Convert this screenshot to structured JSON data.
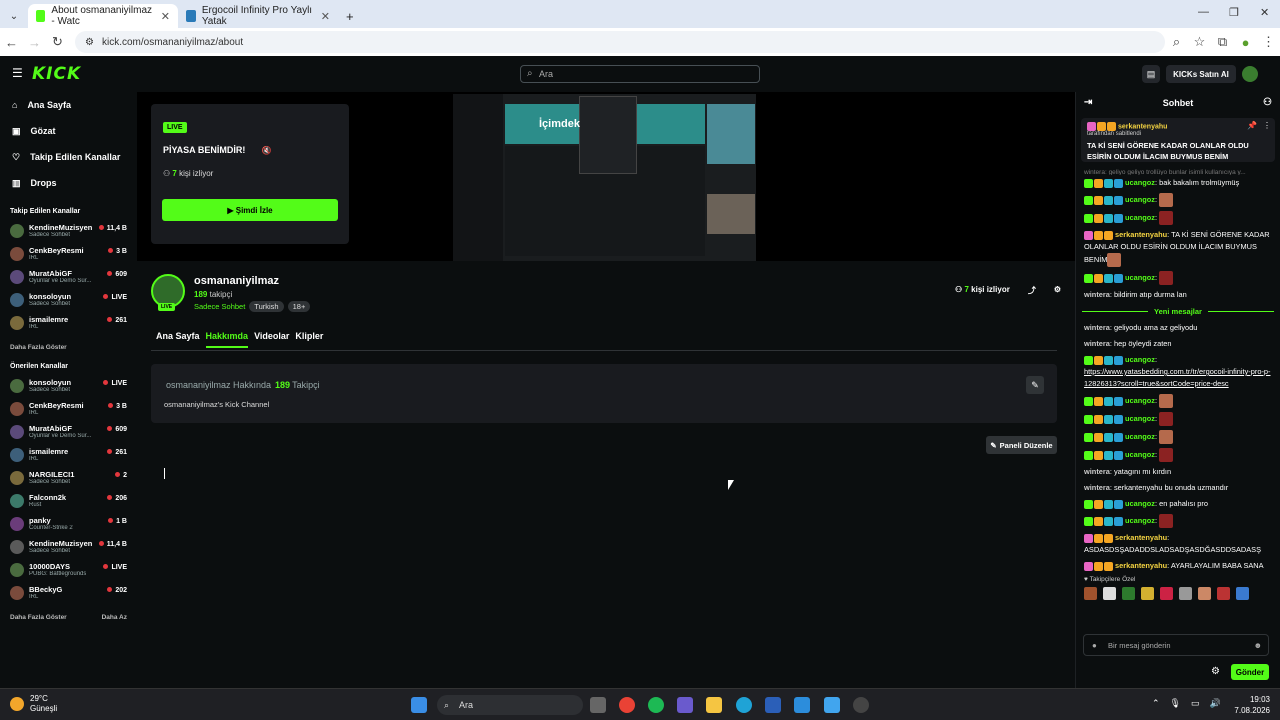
{
  "browser": {
    "tabs": [
      {
        "label": "About osmananiyilmaz - Watc",
        "active": true,
        "color": "#53fc18"
      },
      {
        "label": "Ergocoil Infinity Pro Yaylı Yatak",
        "active": false,
        "color": "#2a7ab8"
      }
    ],
    "url": "kick.com/osmananiyilmaz/about"
  },
  "header": {
    "logo": "KICK",
    "search_placeholder": "Ara",
    "buy_label": "KICKs Satın Al"
  },
  "sidebar": {
    "nav": [
      {
        "label": "Ana Sayfa",
        "icon": "home-icon"
      },
      {
        "label": "Gözat",
        "icon": "browse-icon"
      },
      {
        "label": "Takip Edilen Kanallar",
        "icon": "heart-icon"
      },
      {
        "label": "Drops",
        "icon": "drops-icon"
      }
    ],
    "followed_title": "Takip Edilen Kanallar",
    "followed": [
      {
        "name": "KendineMuzisyen",
        "cat": "Sadece Sohbet",
        "count": "11,4 B"
      },
      {
        "name": "CenkBeyResmi",
        "cat": "IRL",
        "count": "3 B"
      },
      {
        "name": "MuratAbiGF",
        "cat": "Oyunlar ve Demo Sür...",
        "count": "609"
      },
      {
        "name": "konsoloyun",
        "cat": "Sadece Sohbet",
        "count": "LIVE"
      },
      {
        "name": "ismailemre",
        "cat": "IRL",
        "count": "261"
      }
    ],
    "show_more": "Daha Fazla Göster",
    "recommended_title": "Önerilen Kanallar",
    "recommended": [
      {
        "name": "konsoloyun",
        "cat": "Sadece Sohbet",
        "count": "LIVE"
      },
      {
        "name": "CenkBeyResmi",
        "cat": "IRL",
        "count": "3 B"
      },
      {
        "name": "MuratAbiGF",
        "cat": "Oyunlar ve Demo Sür...",
        "count": "609"
      },
      {
        "name": "ismailemre",
        "cat": "IRL",
        "count": "261"
      },
      {
        "name": "NARGILECI1",
        "cat": "Sadece Sohbet",
        "count": "2"
      },
      {
        "name": "Falconn2k",
        "cat": "Rust",
        "count": "206"
      },
      {
        "name": "panky",
        "cat": "Counter-Strike 2",
        "count": "1 B"
      },
      {
        "name": "KendineMuzisyen",
        "cat": "Sadece Sohbet",
        "count": "11,4 B"
      },
      {
        "name": "10000DAYS",
        "cat": "PUBG: Battlegrounds",
        "count": "LIVE"
      },
      {
        "name": "BBeckyG",
        "cat": "IRL",
        "count": "202"
      }
    ],
    "show_more2": "Daha Fazla Göster",
    "show_less": "Daha Az"
  },
  "player": {
    "badge": "LIVE",
    "title": "PİYASA BENİMDİR!",
    "viewers_count": "7",
    "viewers_text": "kişi izliyor",
    "watch_label": "Şimdi İzle",
    "preview_text": "İçimdek"
  },
  "channel": {
    "name": "osmananiyilmaz",
    "followers": "189",
    "followers_text": "takipçi",
    "category": "Sadece Sohbet",
    "tags": [
      "Turkish",
      "18+"
    ],
    "viewers": "7",
    "viewers_text": "kişi izliyor",
    "live_badge": "LIVE"
  },
  "tabs": [
    "Ana Sayfa",
    "Hakkımda",
    "Videolar",
    "Klipler"
  ],
  "about": {
    "title": "osmananiyilmaz Hakkında",
    "followers": "189",
    "followers_label": "Takipçi",
    "description": "osmananiyilmaz's Kick Channel",
    "panel_button": "Paneli Düzenle"
  },
  "chat": {
    "title": "Sohbet",
    "pinned": {
      "user": "serkantenyahu",
      "sub": "tarafından sabitlendi",
      "text": "TA Kİ SENİ GÖRENE KADAR OLANLAR OLDU ESİRİN OLDUM İLACIM BUYMUS BENİM"
    },
    "faded": "wintera: geliyo geliyo trollüyo bunlar isimli kullanıcıya y...",
    "messages_before": [
      {
        "user": "ucangoz",
        "text": "bak bakalım trolmüymüş",
        "type": "g"
      },
      {
        "user": "ucangoz",
        "text": "",
        "emote": true,
        "type": "g"
      },
      {
        "user": "ucangoz",
        "text": "",
        "emote": true,
        "type": "g"
      },
      {
        "user": "serkantenyahu",
        "text": "TA Kİ SENİ GÖRENE KADAR OLANLAR OLDU ESİRİN OLDUM İLACIM BUYMUS BENİM",
        "emote": true,
        "type": "p"
      },
      {
        "user": "ucangoz",
        "text": "",
        "emote": true,
        "type": "g"
      },
      {
        "user": "wintera",
        "text": "bildirim atıp durma lan",
        "type": "w"
      }
    ],
    "new_messages": "Yeni mesajlar",
    "messages_after": [
      {
        "user": "wintera",
        "text": "geliyodu ama az geliyodu",
        "type": "w"
      },
      {
        "user": "wintera",
        "text": "hep öyleydi zaten",
        "type": "w"
      },
      {
        "user": "ucangoz",
        "text": "https://www.yatasbedding.com.tr/tr/ergocoil-infinity-pro-p-12826313?scroll=true&sortCode=price-desc",
        "type": "g",
        "link": true
      },
      {
        "user": "ucangoz",
        "text": "",
        "emote": true,
        "type": "g"
      },
      {
        "user": "ucangoz",
        "text": "",
        "emote": true,
        "type": "g"
      },
      {
        "user": "ucangoz",
        "text": "",
        "emote": true,
        "type": "g"
      },
      {
        "user": "ucangoz",
        "text": "",
        "emote": true,
        "type": "g"
      },
      {
        "user": "wintera",
        "text": "yatagını mı kırdın",
        "type": "w"
      },
      {
        "user": "wintera",
        "text": "serkantenyahu bu onuda uzmandır",
        "type": "w"
      },
      {
        "user": "ucangoz",
        "text": "en pahalısı pro",
        "type": "g"
      },
      {
        "user": "ucangoz",
        "text": "",
        "emote": true,
        "type": "g"
      },
      {
        "user": "serkantenyahu",
        "text": "ASDASDSŞADADDSLADSADŞASDĞASDDSADASŞ",
        "type": "p"
      },
      {
        "user": "serkantenyahu",
        "text": "AYARLAYALIM BABA SANA",
        "type": "p"
      }
    ],
    "sub_only": "Takipçilere Özel",
    "input_placeholder": "Bir mesaj gönderin",
    "send_label": "Gönder"
  },
  "taskbar": {
    "temp": "29°C",
    "weather": "Güneşli",
    "search": "Ara",
    "time": "19:03",
    "date": "7.08.2026"
  }
}
